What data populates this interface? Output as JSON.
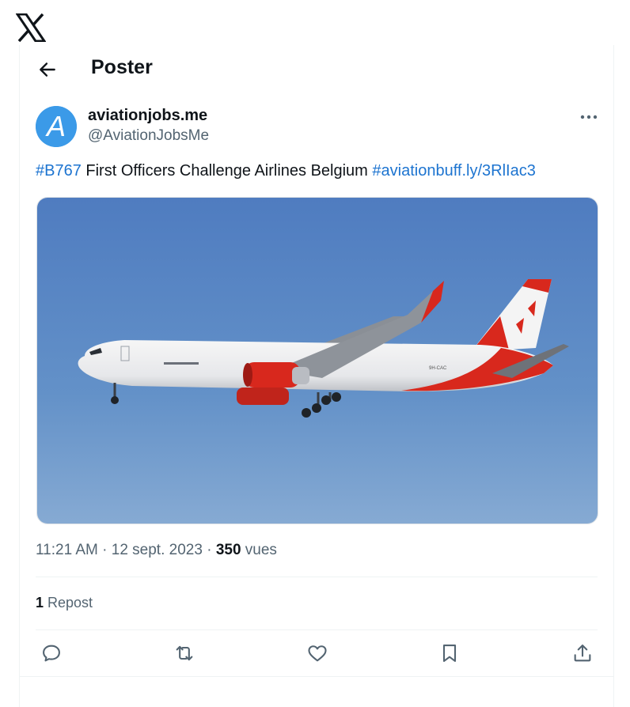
{
  "header": {
    "title": "Poster"
  },
  "tweet": {
    "avatar_letter": "A",
    "display_name": "aviationjobs.me",
    "handle": "@AviationJobsMe",
    "text": {
      "hashtag1": "#B767",
      "body": " First Officers Challenge Airlines Belgium ",
      "hashtag2": "#aviation",
      "link": "buff.ly/3RlIac3"
    },
    "image": {
      "registration": "9H-CAC"
    },
    "meta": {
      "time": "11:21 AM",
      "sep1": " · ",
      "date": "12 sept. 2023",
      "sep2": " · ",
      "views_count": "350",
      "views_label": " vues"
    },
    "reposts": {
      "count": "1",
      "label": " Repost"
    }
  },
  "colors": {
    "link": "#1d74d0",
    "avatar": "#3b9ae8",
    "livery_red": "#d8281d",
    "sky": "#5a86c4"
  }
}
